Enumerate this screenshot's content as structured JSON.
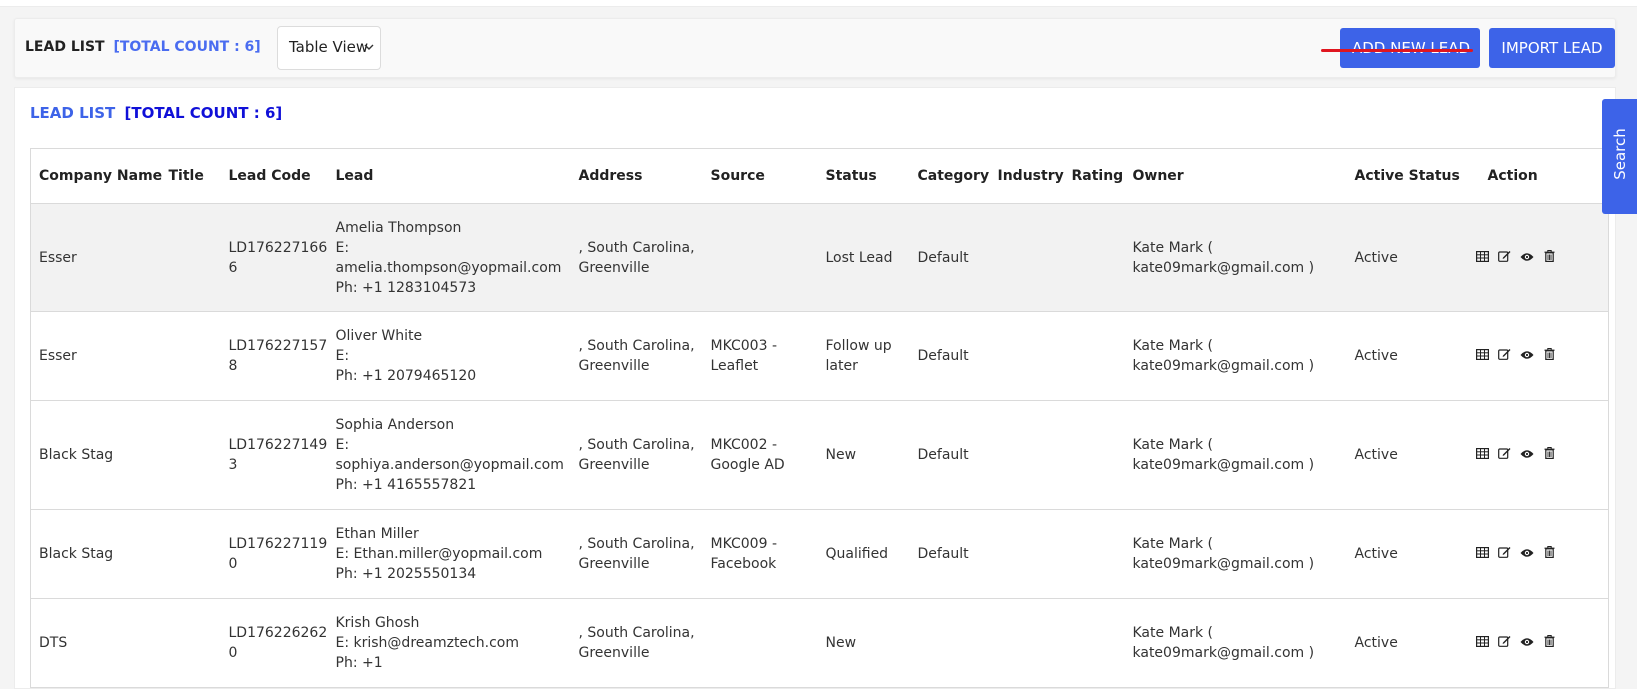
{
  "header": {
    "title": "LEAD LIST",
    "count_label": "[TOTAL COUNT : 6]",
    "view_select": "Table View",
    "add_button": "ADD NEW LEAD",
    "import_button": "IMPORT LEAD"
  },
  "main": {
    "title": "LEAD LIST",
    "count_label": "[TOTAL COUNT : 6]"
  },
  "search_tab": "Search",
  "table": {
    "columns": [
      "Company Name",
      "Title",
      "Lead Code",
      "Lead",
      "Address",
      "Source",
      "Status",
      "Category",
      "Industry",
      "Rating",
      "Owner",
      "Active Status",
      "Action"
    ],
    "rows": [
      {
        "company": "Esser",
        "title": "",
        "code": "LD1762271666",
        "lead_name": "Amelia Thompson",
        "lead_email": "E: amelia.thompson@yopmail.com",
        "lead_phone": "Ph: +1 1283104573",
        "address": ", South Carolina, Greenville",
        "source": "",
        "status": "Lost Lead",
        "category": "Default",
        "industry": "",
        "rating": "",
        "owner": "Kate Mark ( kate09mark@gmail.com )",
        "active": "Active"
      },
      {
        "company": "Esser",
        "title": "",
        "code": "LD1762271578",
        "lead_name": "Oliver White",
        "lead_email": "E:",
        "lead_phone": "Ph: +1 2079465120",
        "address": ", South Carolina, Greenville",
        "source": "MKC003 - Leaflet",
        "status": "Follow up later",
        "category": "Default",
        "industry": "",
        "rating": "",
        "owner": "Kate Mark ( kate09mark@gmail.com )",
        "active": "Active"
      },
      {
        "company": "Black Stag",
        "title": "",
        "code": "LD1762271493",
        "lead_name": "Sophia Anderson",
        "lead_email": "E: sophiya.anderson@yopmail.com",
        "lead_phone": "Ph: +1 4165557821",
        "address": ", South Carolina, Greenville",
        "source": "MKC002 - Google AD",
        "status": "New",
        "category": "Default",
        "industry": "",
        "rating": "",
        "owner": "Kate Mark ( kate09mark@gmail.com )",
        "active": "Active"
      },
      {
        "company": "Black Stag",
        "title": "",
        "code": "LD1762271190",
        "lead_name": "Ethan Miller",
        "lead_email": "E: Ethan.miller@yopmail.com",
        "lead_phone": "Ph: +1 2025550134",
        "address": ", South Carolina, Greenville",
        "source": "MKC009 - Facebook",
        "status": "Qualified",
        "category": "Default",
        "industry": "",
        "rating": "",
        "owner": "Kate Mark ( kate09mark@gmail.com )",
        "active": "Active"
      },
      {
        "company": "DTS",
        "title": "",
        "code": "LD1762262620",
        "lead_name": "Krish Ghosh",
        "lead_email": "E: krish@dreamztech.com",
        "lead_phone": "Ph: +1",
        "address": ", South Carolina, Greenville",
        "source": "",
        "status": "New",
        "category": "",
        "industry": "",
        "rating": "",
        "owner": "Kate Mark ( kate09mark@gmail.com )",
        "active": "Active"
      }
    ]
  },
  "icons": {
    "table": "table-icon",
    "edit": "edit-icon",
    "view": "eye-icon",
    "delete": "trash-icon"
  },
  "colors": {
    "accent": "#3d63e8",
    "count_dark": "#1010d8",
    "underline": "#e0161f"
  }
}
